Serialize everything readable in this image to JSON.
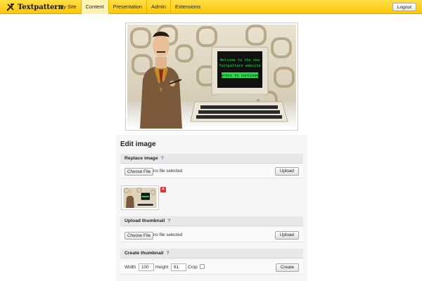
{
  "header": {
    "logo_text": "Textpattern",
    "nav": [
      "My Site",
      "Content",
      "Presentation",
      "Admin",
      "Extensions"
    ],
    "active_nav": "Content",
    "logout_label": "Logout"
  },
  "preview": {
    "screen_lines": [
      "Welcome to the new",
      "Textpattern website",
      "press to continue"
    ]
  },
  "panel": {
    "title": "Edit image",
    "replace": {
      "heading": "Replace image",
      "help": "?",
      "file_button": "Choose File",
      "file_status": "no file selected",
      "upload_label": "Upload"
    },
    "thumbnail": {
      "delete_label": "×"
    },
    "upload_thumbnail": {
      "heading": "Upload thumbnail",
      "help": "?",
      "file_button": "Choose File",
      "file_status": "no file selected",
      "upload_label": "Upload"
    },
    "create_thumbnail": {
      "heading": "Create thumbnail",
      "help": "?",
      "width_label": "Width",
      "width_value": "100",
      "height_label": "Height",
      "height_value": "61",
      "crop_label": "Crop",
      "crop_checked": false,
      "create_label": "Create"
    }
  },
  "colors": {
    "topbar": "#fcc70a",
    "active_nav": "#fff3b2",
    "help": "#3b6fc2",
    "delete": "#dd3333",
    "screen_text": "#22dd44"
  },
  "icons": [
    "textpattern-logo-icon",
    "help-icon",
    "delete-icon"
  ]
}
